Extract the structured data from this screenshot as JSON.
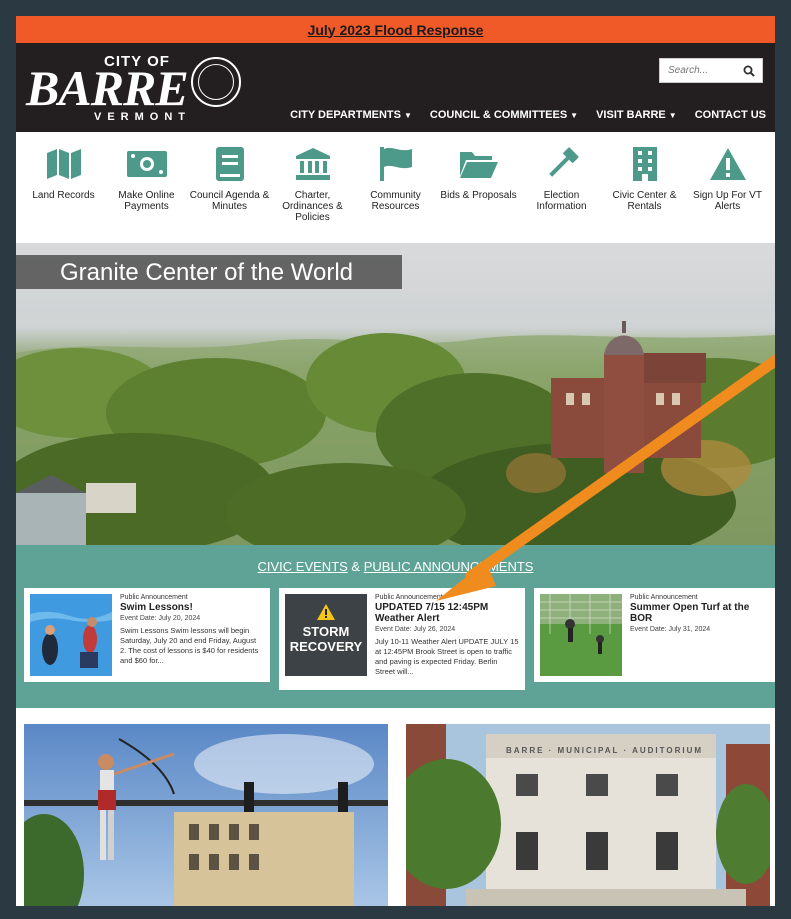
{
  "alert": {
    "label": "July 2023 Flood Response"
  },
  "logo": {
    "city_of": "CITY OF",
    "barre": "BARRE",
    "vermont": "VERMONT"
  },
  "search": {
    "placeholder": "Search..."
  },
  "nav": [
    {
      "label": "CITY DEPARTMENTS",
      "dropdown": true
    },
    {
      "label": "COUNCIL & COMMITTEES",
      "dropdown": true
    },
    {
      "label": "VISIT BARRE",
      "dropdown": true
    },
    {
      "label": "CONTACT US",
      "dropdown": false
    }
  ],
  "quick_links": [
    {
      "label": "Land Records",
      "icon": "map-icon"
    },
    {
      "label": "Make Online Payments",
      "icon": "money-icon"
    },
    {
      "label": "Council Agenda & Minutes",
      "icon": "book-icon"
    },
    {
      "label": "Charter, Ordinances & Policies",
      "icon": "government-building-icon"
    },
    {
      "label": "Community Resources",
      "icon": "flag-icon"
    },
    {
      "label": "Bids & Proposals",
      "icon": "folder-icon"
    },
    {
      "label": "Election Information",
      "icon": "gavel-icon"
    },
    {
      "label": "Civic Center & Rentals",
      "icon": "building-icon"
    },
    {
      "label": "Sign Up For VT Alerts",
      "icon": "warning-icon"
    }
  ],
  "hero": {
    "title": "Granite Center of the World"
  },
  "events_header": {
    "civic": "CIVIC EVENTS",
    "amp": " & ",
    "public": "PUBLIC ANNOUNCEMENTS"
  },
  "events": [
    {
      "category": "Public Announcement",
      "title": "Swim Lessons!",
      "date": "Event Date: July 20, 2024",
      "description": "Swim Lessons Swim lessons will begin Saturday, July 20 and end Friday, August 2. The cost of lessons is $40 for residents and $60 for..."
    },
    {
      "category": "Public Announcement",
      "title": "UPDATED 7/15 12:45PM Weather Alert",
      "date": "Event Date: July 26, 2024",
      "description": "July 10-11 Weather Alert UPDATE JULY 15 at 12:45PM Brook Street is open to traffic and paving is expected Friday. Berlin Street will...",
      "thumb_text": [
        "STORM",
        "RECOVERY"
      ]
    },
    {
      "category": "Public Announcement",
      "title": "Summer Open Turf at the BOR",
      "date": "Event Date: July 31, 2024",
      "description": ""
    }
  ],
  "auditorium_sign": "BARRE · MUNICIPAL · AUDITORIUM",
  "colors": {
    "alert": "#f05a28",
    "header": "#231f20",
    "icon_teal": "#4e9a8a",
    "events_bg": "#5fa396",
    "arrow": "#f08c1e"
  }
}
